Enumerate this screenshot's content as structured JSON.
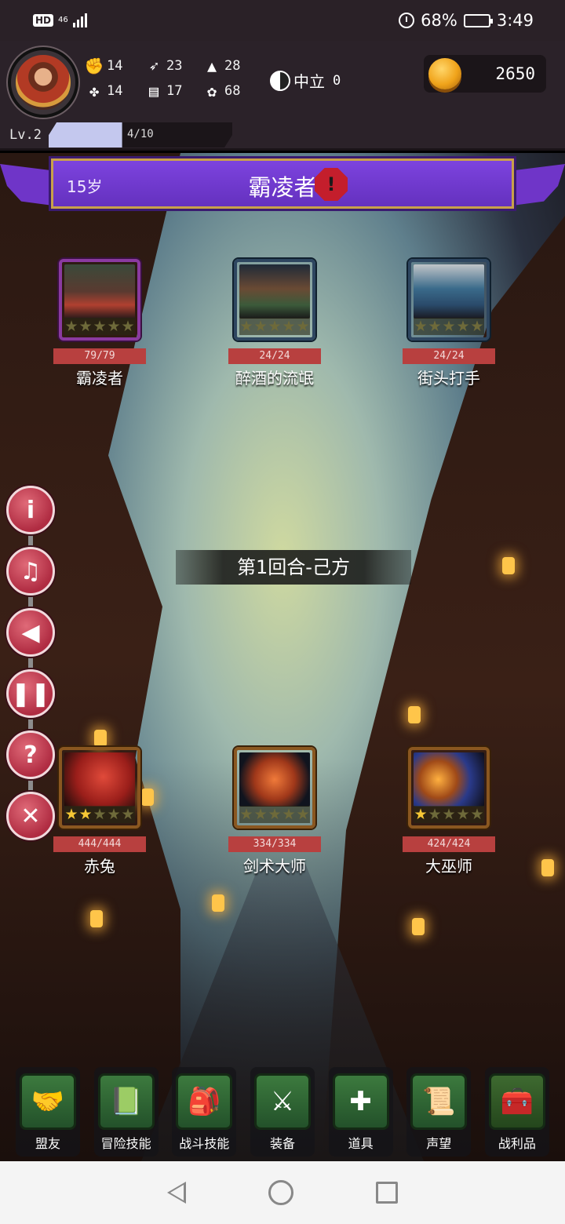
{
  "status_bar": {
    "hd": "HD",
    "network": "46",
    "battery_percent": "68%",
    "battery_level": 0.68,
    "time": "3:49"
  },
  "player": {
    "stats": [
      {
        "icon": "fist-icon",
        "value": "14"
      },
      {
        "icon": "clover-icon",
        "value": "14"
      },
      {
        "icon": "wing-icon",
        "value": "23"
      },
      {
        "icon": "scroll-icon",
        "value": "17"
      },
      {
        "icon": "wizard-hat-icon",
        "value": "28"
      },
      {
        "icon": "lotus-icon",
        "value": "68"
      }
    ],
    "alignment_label": "中立",
    "alignment_value": "0",
    "gold": "2650",
    "level_label": "Lv.2",
    "xp_text": "4/10",
    "xp_progress": 0.4
  },
  "banner": {
    "age": "15岁",
    "title": "霸凌者",
    "accent_color": "#7e44e0"
  },
  "enemies": [
    {
      "name": "霸凌者",
      "hp": "79/79",
      "stars": 0,
      "frame": "purple"
    },
    {
      "name": "醉酒的流氓",
      "hp": "24/24",
      "stars": 0,
      "frame": "blue"
    },
    {
      "name": "街头打手",
      "hp": "24/24",
      "stars": 0,
      "frame": "blue"
    }
  ],
  "allies": [
    {
      "name": "赤兔",
      "hp": "444/444",
      "stars": 2,
      "frame": "gold"
    },
    {
      "name": "剑术大师",
      "hp": "334/334",
      "stars": 0,
      "frame": "gold"
    },
    {
      "name": "大巫师",
      "hp": "424/424",
      "stars": 1,
      "frame": "gold"
    }
  ],
  "round_text": "第1回合-己方",
  "side_controls": [
    "info-icon",
    "music-off-icon",
    "sound-off-icon",
    "pause-icon",
    "help-icon",
    "close-icon"
  ],
  "menu": [
    {
      "label": "盟友",
      "icon": "handshake-icon"
    },
    {
      "label": "冒险技能",
      "icon": "book-icon"
    },
    {
      "label": "战斗技能",
      "icon": "backpack-icon"
    },
    {
      "label": "装备",
      "icon": "crossed-swords-shield-icon"
    },
    {
      "label": "道具",
      "icon": "potion-bag-icon"
    },
    {
      "label": "声望",
      "icon": "scroll-map-icon"
    },
    {
      "label": "战利品",
      "icon": "treasure-chest-icon"
    }
  ]
}
